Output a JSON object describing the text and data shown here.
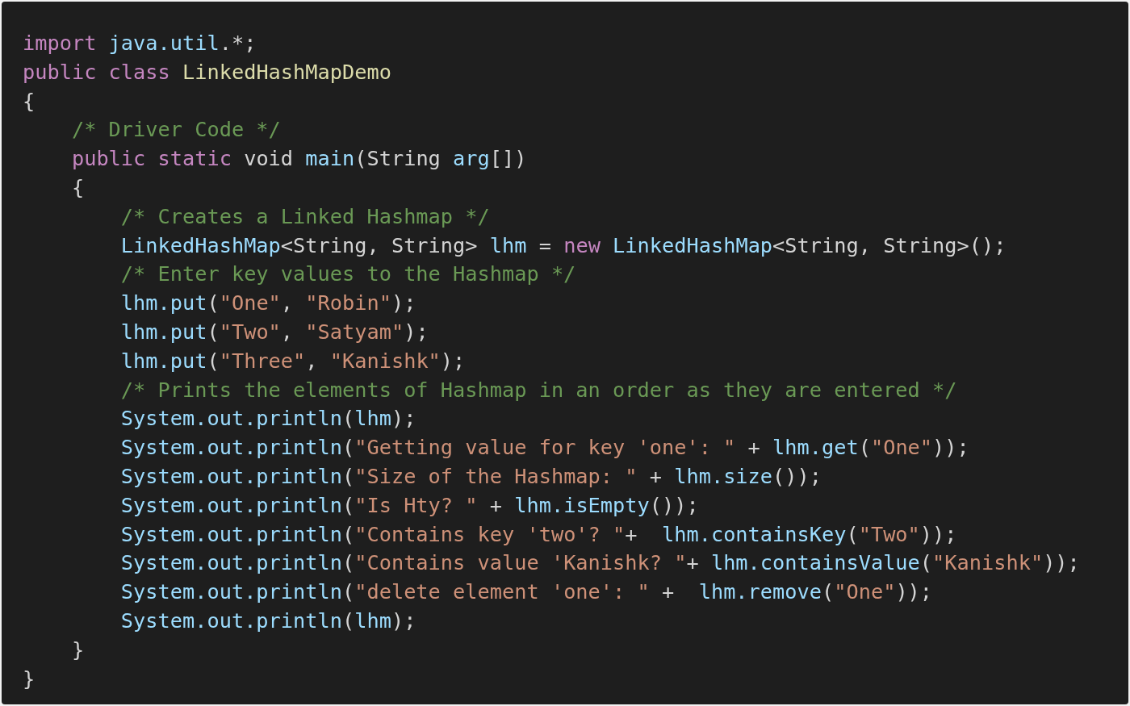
{
  "code": {
    "lines": [
      [
        {
          "kind": "keyword",
          "text": "import"
        },
        {
          "kind": "ident",
          "text": " java.util"
        },
        {
          "kind": "plain",
          "text": ".*;"
        }
      ],
      [
        {
          "kind": "keyword",
          "text": "public class"
        },
        {
          "kind": "type",
          "text": " LinkedHashMapDemo"
        }
      ],
      [
        {
          "kind": "plain",
          "text": "{"
        }
      ],
      [
        {
          "kind": "comment",
          "text": "    /* Driver Code */"
        }
      ],
      [
        {
          "kind": "keyword",
          "text": "    public static"
        },
        {
          "kind": "plain",
          "text": " void "
        },
        {
          "kind": "ident",
          "text": "main"
        },
        {
          "kind": "plain",
          "text": "(String "
        },
        {
          "kind": "ident",
          "text": "arg"
        },
        {
          "kind": "plain",
          "text": "[])"
        }
      ],
      [
        {
          "kind": "plain",
          "text": "    {"
        }
      ],
      [
        {
          "kind": "comment",
          "text": "        /* Creates a Linked Hashmap */"
        }
      ],
      [
        {
          "kind": "ident",
          "text": "        LinkedHashMap"
        },
        {
          "kind": "plain",
          "text": "<String, String> "
        },
        {
          "kind": "ident",
          "text": "lhm"
        },
        {
          "kind": "plain",
          "text": " = "
        },
        {
          "kind": "keyword",
          "text": "new"
        },
        {
          "kind": "ident",
          "text": " LinkedHashMap"
        },
        {
          "kind": "plain",
          "text": "<String, String>();"
        }
      ],
      [
        {
          "kind": "comment",
          "text": "        /* Enter key values to the Hashmap */"
        }
      ],
      [
        {
          "kind": "ident",
          "text": "        lhm.put"
        },
        {
          "kind": "plain",
          "text": "("
        },
        {
          "kind": "string",
          "text": "\"One\""
        },
        {
          "kind": "plain",
          "text": ", "
        },
        {
          "kind": "string",
          "text": "\"Robin\""
        },
        {
          "kind": "plain",
          "text": ");"
        }
      ],
      [
        {
          "kind": "ident",
          "text": "        lhm.put"
        },
        {
          "kind": "plain",
          "text": "("
        },
        {
          "kind": "string",
          "text": "\"Two\""
        },
        {
          "kind": "plain",
          "text": ", "
        },
        {
          "kind": "string",
          "text": "\"Satyam\""
        },
        {
          "kind": "plain",
          "text": ");"
        }
      ],
      [
        {
          "kind": "ident",
          "text": "        lhm.put"
        },
        {
          "kind": "plain",
          "text": "("
        },
        {
          "kind": "string",
          "text": "\"Three\""
        },
        {
          "kind": "plain",
          "text": ", "
        },
        {
          "kind": "string",
          "text": "\"Kanishk\""
        },
        {
          "kind": "plain",
          "text": ");"
        }
      ],
      [
        {
          "kind": "comment",
          "text": "        /* Prints the elements of Hashmap in an order as they are entered */"
        }
      ],
      [
        {
          "kind": "ident",
          "text": "        System.out.println"
        },
        {
          "kind": "plain",
          "text": "("
        },
        {
          "kind": "ident",
          "text": "lhm"
        },
        {
          "kind": "plain",
          "text": ");"
        }
      ],
      [
        {
          "kind": "ident",
          "text": "        System.out.println"
        },
        {
          "kind": "plain",
          "text": "("
        },
        {
          "kind": "string",
          "text": "\"Getting value for key 'one': \""
        },
        {
          "kind": "plain",
          "text": " + "
        },
        {
          "kind": "ident",
          "text": "lhm.get"
        },
        {
          "kind": "plain",
          "text": "("
        },
        {
          "kind": "string",
          "text": "\"One\""
        },
        {
          "kind": "plain",
          "text": "));"
        }
      ],
      [
        {
          "kind": "ident",
          "text": "        System.out.println"
        },
        {
          "kind": "plain",
          "text": "("
        },
        {
          "kind": "string",
          "text": "\"Size of the Hashmap: \""
        },
        {
          "kind": "plain",
          "text": " + "
        },
        {
          "kind": "ident",
          "text": "lhm.size"
        },
        {
          "kind": "plain",
          "text": "());"
        }
      ],
      [
        {
          "kind": "ident",
          "text": "        System.out.println"
        },
        {
          "kind": "plain",
          "text": "("
        },
        {
          "kind": "string",
          "text": "\"Is Hty? \""
        },
        {
          "kind": "plain",
          "text": " + "
        },
        {
          "kind": "ident",
          "text": "lhm.isEmpty"
        },
        {
          "kind": "plain",
          "text": "());"
        }
      ],
      [
        {
          "kind": "ident",
          "text": "        System.out.println"
        },
        {
          "kind": "plain",
          "text": "("
        },
        {
          "kind": "string",
          "text": "\"Contains key 'two'? \""
        },
        {
          "kind": "plain",
          "text": "+  "
        },
        {
          "kind": "ident",
          "text": "lhm.containsKey"
        },
        {
          "kind": "plain",
          "text": "("
        },
        {
          "kind": "string",
          "text": "\"Two\""
        },
        {
          "kind": "plain",
          "text": "));"
        }
      ],
      [
        {
          "kind": "ident",
          "text": "        System.out.println"
        },
        {
          "kind": "plain",
          "text": "("
        },
        {
          "kind": "string",
          "text": "\"Contains value 'Kanishk? \""
        },
        {
          "kind": "plain",
          "text": "+ "
        },
        {
          "kind": "ident",
          "text": "lhm.containsValue"
        },
        {
          "kind": "plain",
          "text": "("
        },
        {
          "kind": "string",
          "text": "\"Kanishk\""
        },
        {
          "kind": "plain",
          "text": "));"
        }
      ],
      [
        {
          "kind": "ident",
          "text": "        System.out.println"
        },
        {
          "kind": "plain",
          "text": "("
        },
        {
          "kind": "string",
          "text": "\"delete element 'one': \""
        },
        {
          "kind": "plain",
          "text": " +  "
        },
        {
          "kind": "ident",
          "text": "lhm.remove"
        },
        {
          "kind": "plain",
          "text": "("
        },
        {
          "kind": "string",
          "text": "\"One\""
        },
        {
          "kind": "plain",
          "text": "));"
        }
      ],
      [
        {
          "kind": "ident",
          "text": "        System.out.println"
        },
        {
          "kind": "plain",
          "text": "("
        },
        {
          "kind": "ident",
          "text": "lhm"
        },
        {
          "kind": "plain",
          "text": ");"
        }
      ],
      [
        {
          "kind": "plain",
          "text": "    }"
        }
      ],
      [
        {
          "kind": "plain",
          "text": "}"
        }
      ]
    ]
  }
}
